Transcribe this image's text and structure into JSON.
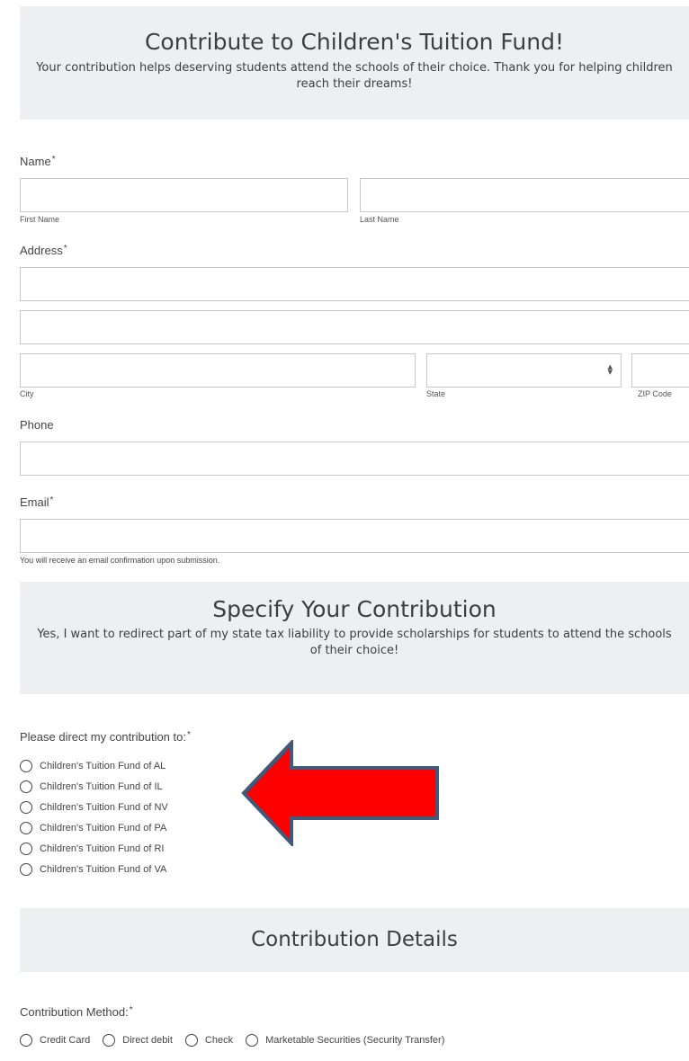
{
  "header": {
    "title": "Contribute to Children's Tuition Fund!",
    "subtitle": "Your contribution helps deserving students attend the schools of their choice. Thank you for helping children reach their dreams!"
  },
  "form": {
    "name_label": "Name",
    "first_name_sublabel": "First Name",
    "last_name_sublabel": "Last Name",
    "address_label": "Address",
    "city_sublabel": "City",
    "state_sublabel": "State",
    "zip_sublabel": "ZIP Code",
    "phone_label": "Phone",
    "email_label": "Email",
    "email_note": "You will receive an email confirmation upon submission.",
    "required_mark": "*"
  },
  "contribution": {
    "title": "Specify Your Contribution",
    "subtitle": "Yes, I want to redirect part of my state tax liability to provide scholarships for students to attend the schools of their choice!",
    "direct_label": "Please direct my contribution to:",
    "funds": [
      "Children's Tuition Fund of AL",
      "Children's Tuition Fund of IL",
      "Children's Tuition Fund of NV",
      "Children's Tuition Fund of PA",
      "Children's Tuition Fund of RI",
      "Children's Tuition Fund of VA"
    ]
  },
  "details": {
    "title": "Contribution Details",
    "method_label": "Contribution Method:",
    "methods": [
      "Credit Card",
      "Direct debit",
      "Check",
      "Marketable Securities (Security Transfer)"
    ]
  },
  "colors": {
    "banner_bg": "#eeeff1",
    "arrow_fill": "#ff0000",
    "arrow_stroke": "#3f5a7a"
  },
  "icons": {
    "annotation": "red-arrow-left-icon",
    "select": "select-updown-icon"
  }
}
